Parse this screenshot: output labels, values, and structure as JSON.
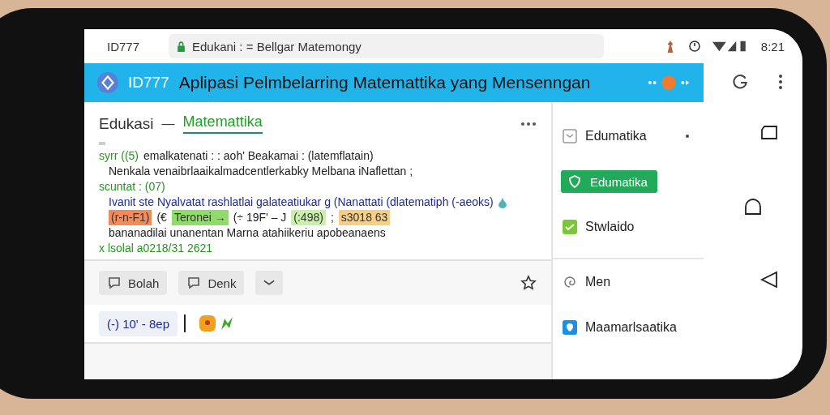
{
  "status_bar": {
    "carrier": "ID777",
    "url": "Edukani : = Bellgar Matemongy",
    "time": "8:21"
  },
  "app_bar": {
    "badge": "ID777",
    "title": "Aplipasi Pelmbelarring Matemattika yang Mensenngan"
  },
  "header": {
    "title": "Edukasi",
    "separator": "—",
    "subject": "Matemattika"
  },
  "lines": [
    {
      "kind": "label",
      "label": "syrr ((5)",
      "text": "emalkatenati : : aoh' Beakamai : (latemflatain)"
    },
    {
      "kind": "plain",
      "text": "Nenkala venaibrlaaikalmadcentlerkabky Melbana iNaflettan ;"
    },
    {
      "kind": "label",
      "label": "scuntat : (07)"
    },
    {
      "kind": "blue",
      "text": "Ivanit ste Nyalvatat rashlatlai galateatiukar g (Nanattati (dlatematiph (-aeoks)"
    },
    {
      "kind": "tags",
      "segments": [
        {
          "text": "(r-n-F1)",
          "color": "#f28a5a"
        },
        {
          "text": "(€"
        },
        {
          "text": "Teronei →",
          "color": "#8fdc6a"
        },
        {
          "text": "(÷ 19F' – J"
        },
        {
          "text": "(:498)",
          "color": "#c9f0a8"
        },
        {
          "text": ";"
        },
        {
          "text": "s3018 63",
          "color": "#f6cf86"
        }
      ]
    },
    {
      "kind": "plain",
      "text": "bananadilai unanentan Marna atahiikeriu apobeanaens"
    },
    {
      "kind": "label",
      "label": "x lsolal a0218/31 2621"
    }
  ],
  "actions": [
    {
      "label": "Bolah"
    },
    {
      "label": "Denk"
    }
  ],
  "chip": "(-) 10' - 8ep",
  "sidebar": {
    "items": [
      {
        "label": "Edumatika",
        "selected": false,
        "kind": "box"
      },
      {
        "label": "Edumatika",
        "selected": true,
        "kind": "shield"
      },
      {
        "label": "Stwlaido",
        "selected": false,
        "kind": "check"
      },
      {
        "label": "Men",
        "selected": false,
        "kind": "swirl"
      },
      {
        "label": "Maamarlsaatika",
        "selected": false,
        "kind": "pin"
      }
    ]
  }
}
